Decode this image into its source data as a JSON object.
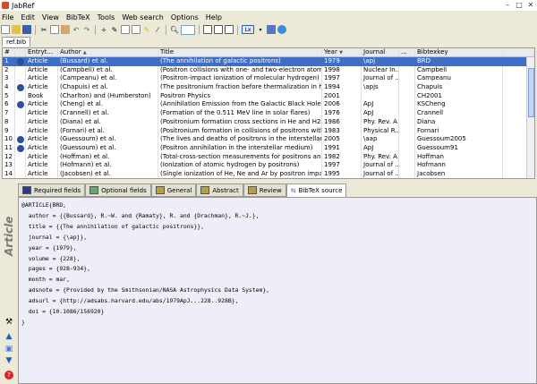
{
  "window": {
    "title": "JabRef"
  },
  "menubar": [
    "File",
    "Edit",
    "View",
    "BibTeX",
    "Tools",
    "Web search",
    "Options",
    "Help"
  ],
  "file_tab": {
    "label": "ref.bib"
  },
  "table": {
    "columns": [
      "#",
      "",
      "Entryt...",
      "Author",
      "Title",
      "Year",
      "Journal",
      "...",
      "Bibtexkey"
    ],
    "sort_indicators": {
      "author": "▲",
      "year": "▼"
    },
    "rows": [
      {
        "num": "1",
        "pdf": true,
        "type": "Article",
        "author": "(Bussard) et al.",
        "title": "(The annihilation of galactic positrons)",
        "year": "1979",
        "journal": "\\apj",
        "key": "BRD",
        "selected": true
      },
      {
        "num": "2",
        "pdf": false,
        "type": "Article",
        "author": "(Campbell) et al.",
        "title": "(Positron collisions with one- and two-electron atoms)",
        "year": "1998",
        "journal": "Nuclear In...",
        "key": "Campbell"
      },
      {
        "num": "3",
        "pdf": false,
        "type": "Article",
        "author": "(Campeanu) et al.",
        "title": "(Positron-impact ionization of molecular hydrogen)",
        "year": "1997",
        "journal": "Journal of ...",
        "key": "Campeanu"
      },
      {
        "num": "4",
        "pdf": true,
        "type": "Article",
        "author": "(Chapuis) et al.",
        "title": "(The positronium fraction before thermalization in hel...",
        "year": "1994",
        "journal": "\\apjs",
        "key": "Chapuis"
      },
      {
        "num": "5",
        "pdf": false,
        "type": "Book",
        "author": "(Charlton) and (Humberston)",
        "title": "Positron Physics",
        "year": "2001",
        "journal": "",
        "key": "CH2001"
      },
      {
        "num": "6",
        "pdf": true,
        "type": "Article",
        "author": "(Cheng) et al.",
        "title": "(Annihilation Emission from the Galactic Black Hole)",
        "year": "2006",
        "journal": "ApJ",
        "key": "KSCheng"
      },
      {
        "num": "7",
        "pdf": false,
        "type": "Article",
        "author": "(Crannell) et al.",
        "title": "(Formation of the 0.511 MeV line in solar flares)",
        "year": "1976",
        "journal": "ApJ",
        "key": "Crannell"
      },
      {
        "num": "8",
        "pdf": false,
        "type": "Article",
        "author": "(Diana) et al.",
        "title": "(Positronium formation cross sections in He and H2 ...",
        "year": "1986",
        "journal": "Phy. Rev. A",
        "key": "Diana"
      },
      {
        "num": "9",
        "pdf": false,
        "type": "Article",
        "author": "(Fornari) et al.",
        "title": "(Positronium formation in collisions of positrons with...",
        "year": "1983",
        "journal": "Physical R...",
        "key": "Fornari"
      },
      {
        "num": "10",
        "pdf": true,
        "type": "Article",
        "author": "(Guessoum) et al.",
        "title": "(The lives and deaths of positrons in the interstellar ...",
        "year": "2005",
        "journal": "\\aap",
        "key": "Guessoum2005"
      },
      {
        "num": "11",
        "pdf": true,
        "type": "Article",
        "author": "(Guessoum) et al.",
        "title": "(Positron annihilation in the interstellar medium)",
        "year": "1991",
        "journal": "ApJ",
        "key": "Guessoum91"
      },
      {
        "num": "12",
        "pdf": false,
        "type": "Article",
        "author": "(Hoffman) et al.",
        "title": "(Total-cross-section measurements for positrons an...",
        "year": "1982",
        "journal": "Phy. Rev. A",
        "key": "Hoffman"
      },
      {
        "num": "13",
        "pdf": false,
        "type": "Article",
        "author": "(Hofmann) et al.",
        "title": "(Ionization of atomic hydrogen by positrons)",
        "year": "1997",
        "journal": "Journal of ...",
        "key": "Hofmann"
      },
      {
        "num": "14",
        "pdf": false,
        "type": "Article",
        "author": "(Jacobsen) et al.",
        "title": "(Single ionization of He, Ne and Ar by positron impact )",
        "year": "1995",
        "journal": "Journal of ...",
        "key": "Jacobsen"
      }
    ]
  },
  "entry_tabs": [
    {
      "label": "Required fields",
      "color": "#2a3b8f"
    },
    {
      "label": "Optional fields",
      "color": "#5fae6a"
    },
    {
      "label": "General",
      "color": "#b5a23a"
    },
    {
      "label": "Abstract",
      "color": "#b5a23a"
    },
    {
      "label": "Review",
      "color": "#b5a23a"
    },
    {
      "label": "BibTeX source",
      "color": "",
      "active": true
    }
  ],
  "sidebar_label": "Article",
  "bibtex_source": "@ARTICLE{BRD,\n  author = {{Bussard}, R.~W. and {Ramaty}, R. and {Drachman}, R.~J.},\n  title = {{The annihilation of galactic positrons}},\n  journal = {\\apj},\n  year = {1979},\n  volume = {228},\n  pages = {928-934},\n  month = mar,\n  adsnote = {Provided by the Smithsonian/NASA Astrophysics Data System},\n  adsurl = {http://adsabs.harvard.edu/abs/1979ApJ...228..928B},\n  doi = {10.1086/156920}\n}",
  "colors": {
    "selection": "#3f6ec7",
    "source_bg": "#eeeef8"
  }
}
